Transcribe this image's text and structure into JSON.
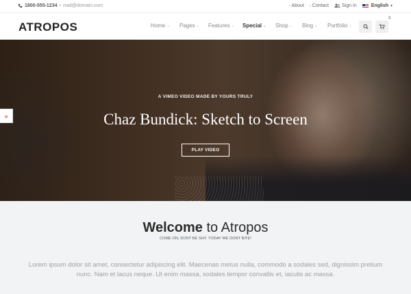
{
  "topbar": {
    "phone": "1800-555-1234",
    "separator": "•",
    "email": "mail@domain.com",
    "links": {
      "about": "About",
      "contact": "Contact",
      "sign_in": "Sign In"
    },
    "language": "English"
  },
  "header": {
    "logo": "ATROPOS",
    "nav": [
      "Home",
      "Pages",
      "Features",
      "Special",
      "Shop",
      "Blog",
      "Portfolio"
    ],
    "cart_count": "3"
  },
  "hero": {
    "subtitle": "A VIMEO VIDEO MADE BY YOURS TRULY",
    "title": "Chaz Bundick: Sketch to Screen",
    "button": "PLAY VIDEO",
    "side_tab": "»"
  },
  "welcome": {
    "title_strong": "Welcome",
    "title_rest": " to Atropos",
    "tagline": "COME ON, DONT BE SHY. TODAY WE DONT BITE!",
    "body": "Lorem ipsum dolor sit amet, consectetur adipiscing elit. Maecenas metus nulla, commodo a sodales sed, dignissim pretium nunc. Nam et lacus neque. Ut enim massa, sodales tempor convallis et, iaculis ac massa."
  },
  "colors": {
    "accent": "#e0522f",
    "welcome_bg": "#f2f3f5",
    "body_text": "#a0a0a0"
  },
  "icons": {
    "phone": "phone-icon",
    "about": "chevron-right-icon",
    "contact": "chevron-right-icon",
    "sign_in": "users-icon",
    "language": "us-flag-icon",
    "search": "search-icon",
    "cart": "cart-icon"
  }
}
